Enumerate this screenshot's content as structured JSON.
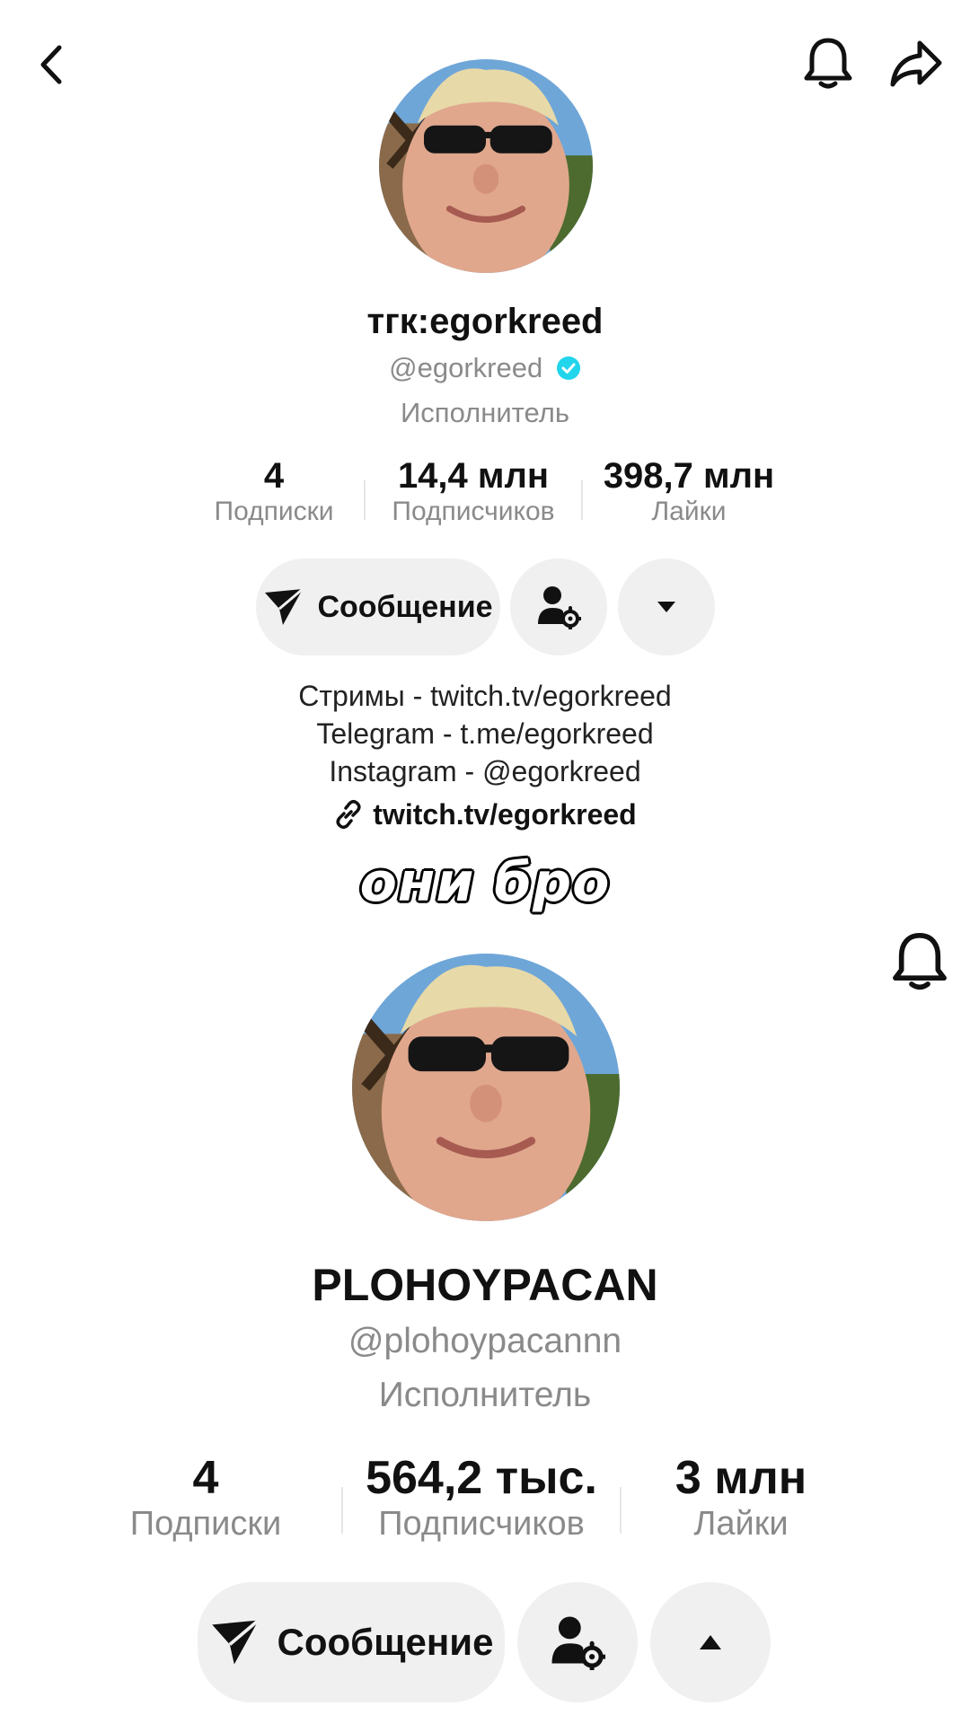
{
  "top_bar": {
    "back_icon": "chevron-left-icon",
    "bell_icon": "bell-icon",
    "share_icon": "share-arrow-icon"
  },
  "profile_top": {
    "display_name": "тгк:egorkreed",
    "handle": "@egorkreed",
    "verified": true,
    "role": "Исполнитель",
    "stats": [
      {
        "value": "4",
        "label": "Подписки"
      },
      {
        "value": "14,4 млн",
        "label": "Подписчиков"
      },
      {
        "value": "398,7 млн",
        "label": "Лайки"
      }
    ],
    "message_label": "Сообщение",
    "bio_lines": [
      "Стримы - twitch.tv/egorkreed",
      "Telegram - t.me/egorkreed",
      "Instagram - @egorkreed"
    ],
    "link": "twitch.tv/egorkreed"
  },
  "caption": "они бро",
  "profile_bottom": {
    "display_name": "PLOHOYPACAN",
    "handle": "@plohoypacannn",
    "role": "Исполнитель",
    "stats": [
      {
        "value": "4",
        "label": "Подписки"
      },
      {
        "value": "564,2 тыс.",
        "label": "Подписчиков"
      },
      {
        "value": "3 млн",
        "label": "Лайки"
      }
    ],
    "message_label": "Сообщение"
  },
  "colors": {
    "verified": "#20D5EC",
    "button_bg": "#F0F0F0",
    "muted_text": "#8A8A8A"
  }
}
